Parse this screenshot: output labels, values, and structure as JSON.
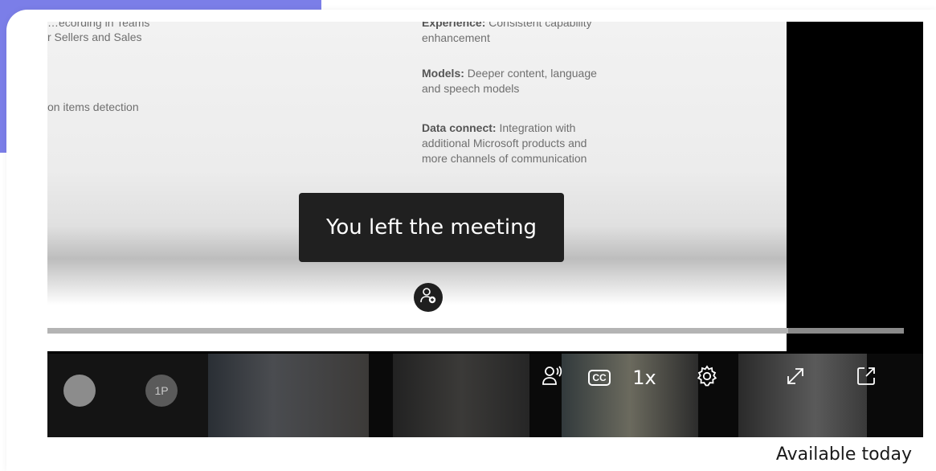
{
  "slide": {
    "left_lines": [
      "…ecording in Teams",
      "r Sellers and Sales",
      "on items detection"
    ],
    "experience_label": "Experience:",
    "experience_text": "Consistent capability",
    "experience_text2": "enhancement",
    "models_label": "Models:",
    "models_text": "Deeper content, language",
    "models_text2": "and speech models",
    "data_label": "Data connect:",
    "data_text": "Integration with",
    "data_text2": "additional Microsoft products and",
    "data_text3": "more channels of communication"
  },
  "toast": {
    "message": "You left the meeting"
  },
  "player": {
    "progress": 0.865
  },
  "participants": {
    "initials_1": "",
    "initials_2": "1P"
  },
  "controls": {
    "audio_icon": "speaker-person-icon",
    "cc_label": "CC",
    "speed_label": "1x",
    "settings_icon": "gear-icon",
    "fullscreen_icon": "expand-icon",
    "popout_icon": "open-external-icon"
  },
  "caption": {
    "text": "Available today"
  },
  "colors": {
    "accent": "#7b7ee8",
    "toast_bg": "#202020",
    "strip_bg": "#0a0a0a"
  }
}
